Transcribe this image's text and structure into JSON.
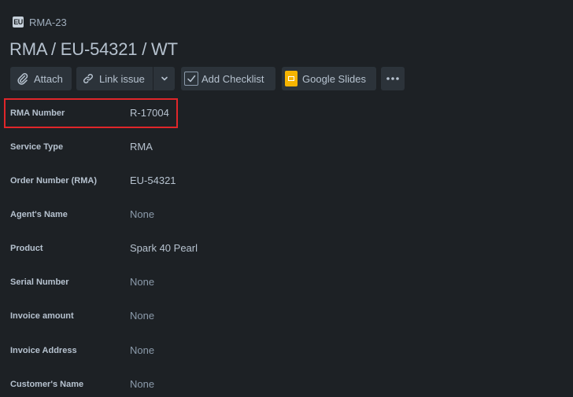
{
  "breadcrumb": {
    "icon": "project-icon",
    "icon_text": "EU",
    "issue_key": "RMA-23"
  },
  "title": "RMA / EU-54321 / WT",
  "toolbar": {
    "attach_label": "Attach",
    "link_issue_label": "Link issue",
    "add_checklist_label": "Add Checklist",
    "google_slides_label": "Google Slides"
  },
  "fields": [
    {
      "label": "RMA Number",
      "value": "R-17004"
    },
    {
      "label": "Service Type",
      "value": "RMA"
    },
    {
      "label": "Order Number (RMA)",
      "value": "EU-54321"
    },
    {
      "label": "Agent's Name",
      "value": "None"
    },
    {
      "label": "Product",
      "value": "Spark 40 Pearl"
    },
    {
      "label": "Serial Number",
      "value": "None"
    },
    {
      "label": "Invoice amount",
      "value": "None"
    },
    {
      "label": "Invoice Address",
      "value": "None"
    },
    {
      "label": "Customer's Name",
      "value": "None"
    }
  ],
  "colors": {
    "background": "#1d2125",
    "button_bg": "#2c333a",
    "text": "#b6c2cf",
    "muted_text": "#8c9bab",
    "highlight": "#e0262a",
    "google_slides": "#f6b400"
  }
}
